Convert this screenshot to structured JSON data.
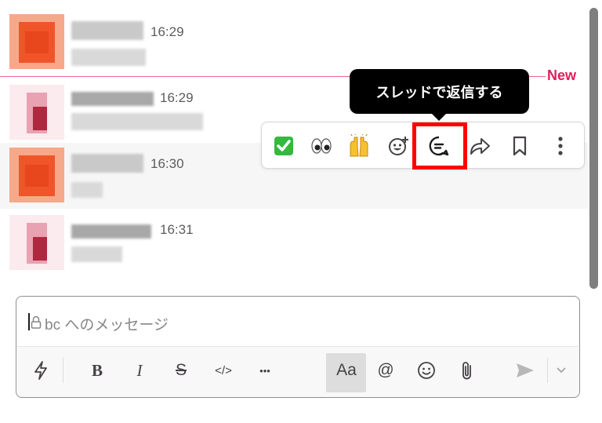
{
  "messages": [
    {
      "time": "16:29"
    },
    {
      "time": "16:29"
    },
    {
      "time": "16:30"
    },
    {
      "time": "16:31"
    }
  ],
  "divider": {
    "label": "New",
    "color": "#e01e5a"
  },
  "tooltip": {
    "text": "スレッドで返信する"
  },
  "hover_toolbar": {
    "items": [
      {
        "name": "check-emoji",
        "glyph": "✅"
      },
      {
        "name": "eyes-emoji",
        "glyph": "👀"
      },
      {
        "name": "raised-hands-emoji",
        "glyph": "🙌"
      },
      {
        "name": "add-reaction",
        "glyph": "😊"
      },
      {
        "name": "reply-in-thread",
        "glyph": "💬"
      },
      {
        "name": "share",
        "glyph": "↪"
      },
      {
        "name": "save",
        "glyph": "🔖"
      },
      {
        "name": "more-actions",
        "glyph": "⋮"
      }
    ],
    "highlight_color": "#ff0000"
  },
  "composer": {
    "placeholder": "bc へのメッセージ",
    "format_buttons": {
      "bold": "B",
      "italic": "I",
      "strike": "S",
      "code": "</>",
      "more": "•••",
      "text_format": "Aa",
      "mention": "@"
    }
  }
}
